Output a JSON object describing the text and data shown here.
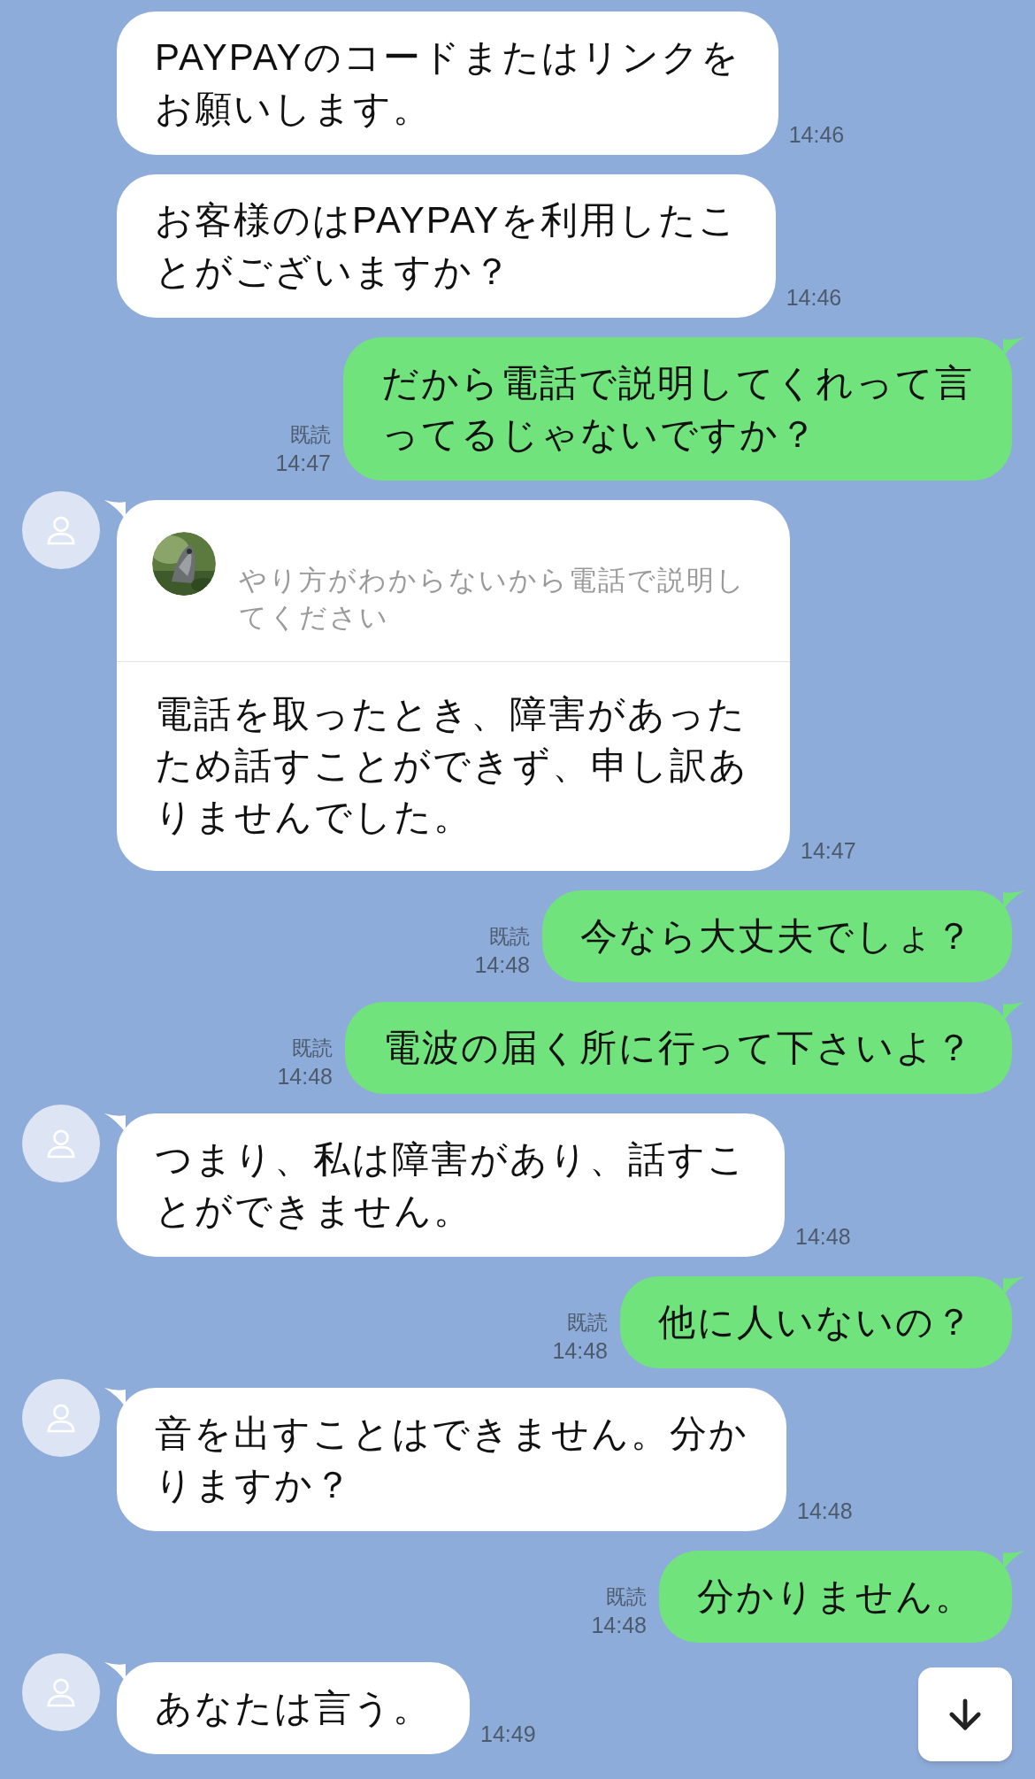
{
  "messages": [
    {
      "kind": "incoming",
      "avatar": false,
      "lines": [
        "PAYPAYのコードまたはリンクを",
        "お願いします。"
      ],
      "time": "14:46"
    },
    {
      "kind": "incoming",
      "avatar": false,
      "lines": [
        "お客様のはPAYPAYを利用したこ",
        "とがございますか？"
      ],
      "time": "14:46"
    },
    {
      "kind": "outgoing",
      "read": "既読",
      "time": "14:47",
      "lines": [
        "だから電話で説明してくれって言",
        "ってるじゃないですか？"
      ]
    },
    {
      "kind": "incoming",
      "avatar": true,
      "quote": {
        "lines": [
          "やり方がわからないから電話で説明し",
          "てください"
        ]
      },
      "lines": [
        "電話を取ったとき、障害があった",
        "ため話すことができず、申し訳あ",
        "りませんでした。"
      ],
      "time": "14:47"
    },
    {
      "kind": "outgoing",
      "read": "既読",
      "time": "14:48",
      "lines": [
        "今なら大丈夫でしょ？"
      ]
    },
    {
      "kind": "outgoing",
      "read": "既読",
      "time": "14:48",
      "lines": [
        "電波の届く所に行って下さいよ？"
      ]
    },
    {
      "kind": "incoming",
      "avatar": true,
      "lines": [
        "つまり、私は障害があり、話すこ",
        "とができません。"
      ],
      "time": "14:48"
    },
    {
      "kind": "outgoing",
      "read": "既読",
      "time": "14:48",
      "lines": [
        "他に人いないの？"
      ]
    },
    {
      "kind": "incoming",
      "avatar": true,
      "lines": [
        "音を出すことはできません。分か",
        "りますか？"
      ],
      "time": "14:48"
    },
    {
      "kind": "outgoing",
      "read": "既読",
      "time": "14:48",
      "lines": [
        "分かりません。"
      ]
    },
    {
      "kind": "incoming",
      "avatar": true,
      "lines": [
        "あなたは言う。"
      ],
      "time": "14:49"
    }
  ]
}
